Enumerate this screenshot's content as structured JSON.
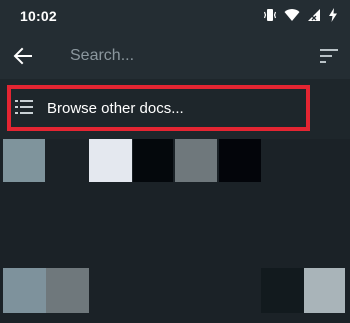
{
  "status_bar": {
    "time": "10:02",
    "icons": [
      "vibrate-icon",
      "wifi-icon",
      "signal-icon",
      "battery-charging-icon"
    ]
  },
  "toolbar": {
    "back_icon": "arrow-left-icon",
    "search_placeholder": "Search...",
    "sort_icon": "sort-icon"
  },
  "browse": {
    "label": "Browse other docs...",
    "icon": "list-icon",
    "highlight_color": "#e42532"
  },
  "thumbnail_colors": {
    "row1": [
      "#7f949c",
      "#1b2227",
      "#e4e8ef",
      "#04080c",
      "#6f787c",
      "#03050a"
    ],
    "row2": [
      "#7e929c",
      "#6f787c",
      "#121a1e",
      "#a9b4b9"
    ]
  },
  "colors": {
    "background": "#1b2227",
    "toolbar": "#242d33",
    "text": "#ffffff",
    "placeholder": "#8b979e"
  }
}
